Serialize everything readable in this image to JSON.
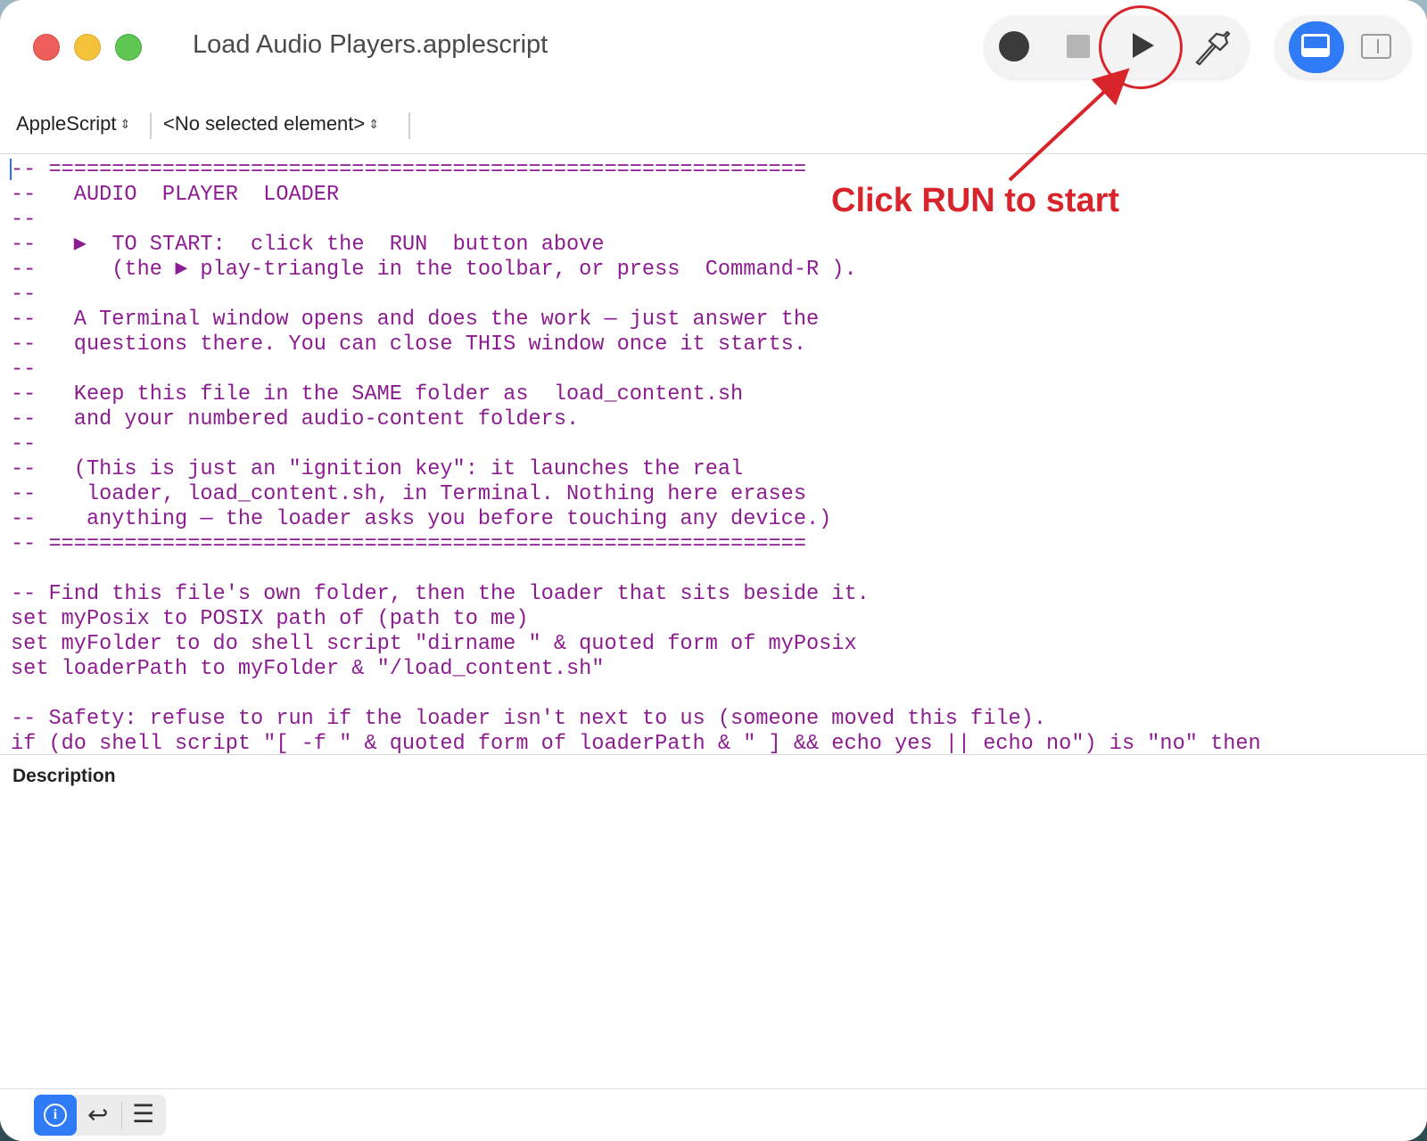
{
  "window": {
    "title": "Load Audio Players.applescript"
  },
  "toolbar": {
    "record_icon": "record-icon",
    "stop_icon": "stop-icon",
    "run_icon": "play-icon",
    "compile_icon": "hammer-icon",
    "view_bottom_icon": "bottom-panel-icon",
    "view_side_icon": "side-panel-icon"
  },
  "navbar": {
    "language": "AppleScript",
    "element": "<No selected element>"
  },
  "editor": {
    "lines": [
      "-- ============================================================",
      "--   AUDIO  PLAYER  LOADER",
      "--",
      "--   ▶  TO START:  click the  RUN  button above",
      "--      (the ► play-triangle in the toolbar, or press  Command-R ).",
      "--",
      "--   A Terminal window opens and does the work — just answer the",
      "--   questions there. You can close THIS window once it starts.",
      "--",
      "--   Keep this file in the SAME folder as  load_content.sh",
      "--   and your numbered audio-content folders.",
      "--",
      "--   (This is just an \"ignition key\": it launches the real",
      "--    loader, load_content.sh, in Terminal. Nothing here erases",
      "--    anything — the loader asks you before touching any device.)",
      "-- ============================================================",
      "",
      "-- Find this file's own folder, then the loader that sits beside it.",
      "set myPosix to POSIX path of (path to me)",
      "set myFolder to do shell script \"dirname \" & quoted form of myPosix",
      "set loaderPath to myFolder & \"/load_content.sh\"",
      "",
      "-- Safety: refuse to run if the loader isn't next to us (someone moved this file).",
      "if (do shell script \"[ -f \" & quoted form of loaderPath & \" ] && echo yes || echo no\") is \"no\" then"
    ]
  },
  "description": {
    "label": "Description",
    "body": ""
  },
  "bottombar": {
    "info_icon": "info-icon",
    "info_glyph": "i",
    "reply_icon": "reply-icon",
    "reply_glyph": "↩",
    "list_icon": "list-icon",
    "list_glyph": "☰"
  },
  "annotation": {
    "text": "Click RUN to start",
    "color": "#d8252c"
  },
  "colors": {
    "comment": "#8c1d90",
    "accent": "#2f7bf6"
  }
}
